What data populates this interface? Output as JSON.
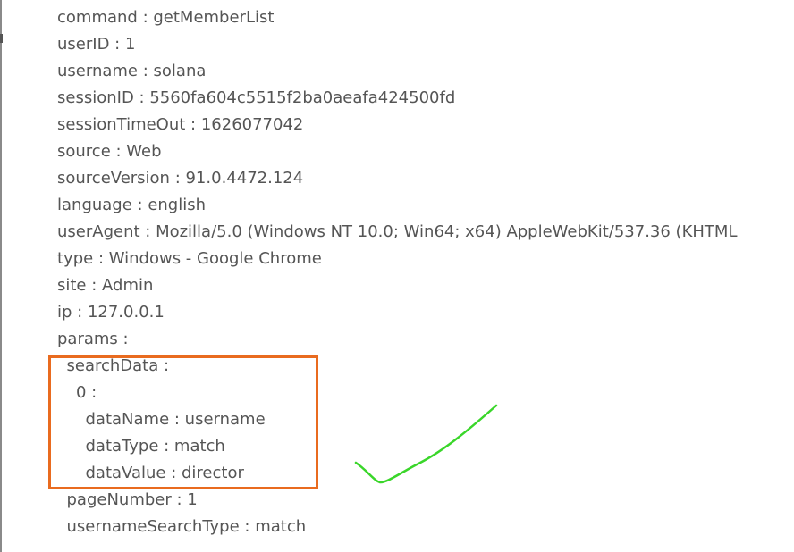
{
  "request": {
    "lines": [
      {
        "key": "command",
        "value": "getMemberList",
        "indent": 0
      },
      {
        "key": "userID",
        "value": "1",
        "indent": 0
      },
      {
        "key": "username",
        "value": "solana",
        "indent": 0
      },
      {
        "key": "sessionID",
        "value": "5560fa604c5515f2ba0aeafa424500fd",
        "indent": 0
      },
      {
        "key": "sessionTimeOut",
        "value": "1626077042",
        "indent": 0
      },
      {
        "key": "source",
        "value": "Web",
        "indent": 0
      },
      {
        "key": "sourceVersion",
        "value": "91.0.4472.124",
        "indent": 0
      },
      {
        "key": "language",
        "value": "english",
        "indent": 0
      },
      {
        "key": "userAgent",
        "value": "Mozilla/5.0 (Windows NT 10.0; Win64; x64) AppleWebKit/537.36 (KHTML",
        "indent": 0
      },
      {
        "key": "type",
        "value": "Windows - Google Chrome",
        "indent": 0
      },
      {
        "key": "site",
        "value": "Admin",
        "indent": 0
      },
      {
        "key": "ip",
        "value": "127.0.0.1",
        "indent": 0
      },
      {
        "key": "params",
        "value": "",
        "indent": 0
      },
      {
        "key": "searchData",
        "value": "",
        "indent": 1
      },
      {
        "key": "0",
        "value": "",
        "indent": 2
      },
      {
        "key": "dataName",
        "value": "username",
        "indent": 3
      },
      {
        "key": "dataType",
        "value": "match",
        "indent": 3
      },
      {
        "key": "dataValue",
        "value": "director",
        "indent": 3
      },
      {
        "key": "pageNumber",
        "value": "1",
        "indent": 1
      },
      {
        "key": "usernameSearchType",
        "value": "match",
        "indent": 1
      }
    ]
  },
  "annotations": {
    "box_color": "#e96b1f",
    "check_color": "#3ad62a"
  }
}
